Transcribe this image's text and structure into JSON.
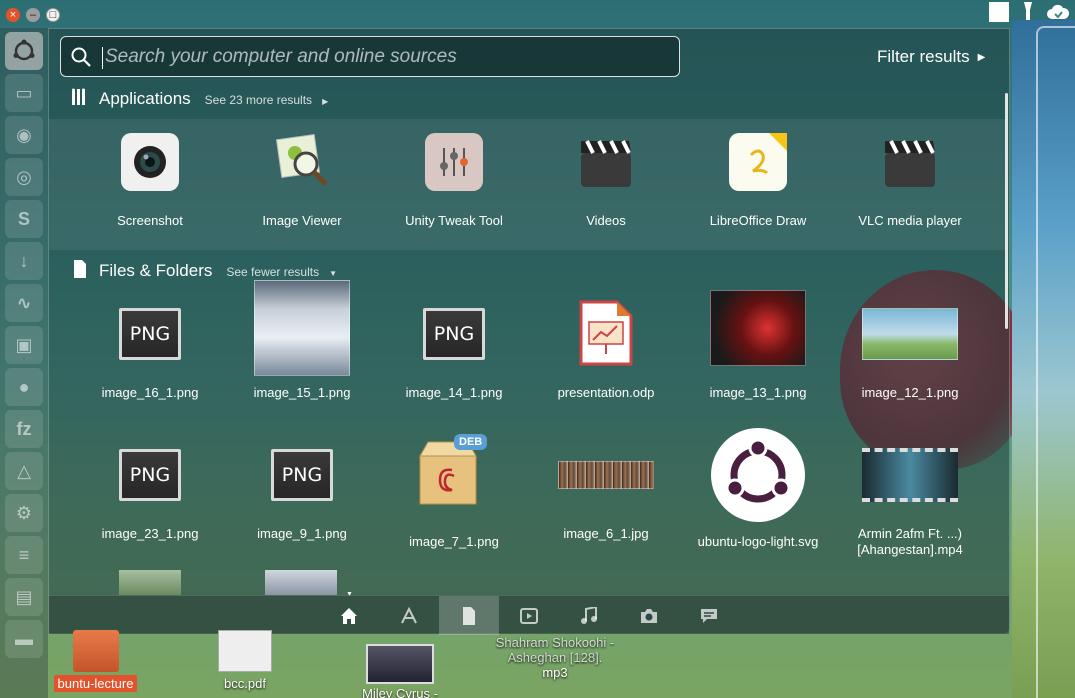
{
  "window_controls": {
    "close_glyph": "×",
    "minimize_glyph": "–",
    "maximize_glyph": "□"
  },
  "search": {
    "placeholder": "Search your computer and online sources",
    "value": ""
  },
  "filter": {
    "label": "Filter results"
  },
  "applications": {
    "title": "Applications",
    "more_label": "See 23 more results",
    "items": [
      {
        "label": "Screenshot",
        "icon": "screenshot-icon"
      },
      {
        "label": "Image Viewer",
        "icon": "image-viewer-icon"
      },
      {
        "label": "Unity Tweak Tool",
        "icon": "unity-tweak-tool-icon"
      },
      {
        "label": "Videos",
        "icon": "videos-icon"
      },
      {
        "label": "LibreOffice Draw",
        "icon": "libreoffice-draw-icon"
      },
      {
        "label": "VLC media player",
        "icon": "vlc-icon"
      }
    ]
  },
  "files": {
    "title": "Files & Folders",
    "more_label": "See fewer results",
    "png_text": "PNG",
    "deb_badge": "DEB",
    "row1": [
      {
        "label": "image_16_1.png"
      },
      {
        "label": "image_15_1.png"
      },
      {
        "label": "image_14_1.png"
      },
      {
        "label": "presentation.odp"
      },
      {
        "label": "image_13_1.png"
      },
      {
        "label": "image_12_1.png"
      }
    ],
    "row2": [
      {
        "label": "image_23_1.png"
      },
      {
        "label": "image_9_1.png"
      },
      {
        "label": "image_7_1.png"
      },
      {
        "label": "image_6_1.jpg"
      },
      {
        "label": "ubuntu-logo-light.svg"
      },
      {
        "label": "Armin 2afm Ft. ...) [Ahangestan].mp4"
      }
    ]
  },
  "lenses": [
    "home-icon",
    "applications-icon",
    "files-icon",
    "video-icon",
    "music-icon",
    "photo-icon",
    "social-icon"
  ],
  "desktop": {
    "items": [
      {
        "label": "buntu-lecture"
      },
      {
        "label": "bcc.pdf"
      },
      {
        "label": "Miley Cyrus -"
      },
      {
        "label": "Shahram Shokoohi - Asheghan [128]."
      },
      {
        "label": "mp3"
      }
    ]
  },
  "colors": {
    "accent": "#e2532d",
    "panel": "#1e3c3c"
  }
}
